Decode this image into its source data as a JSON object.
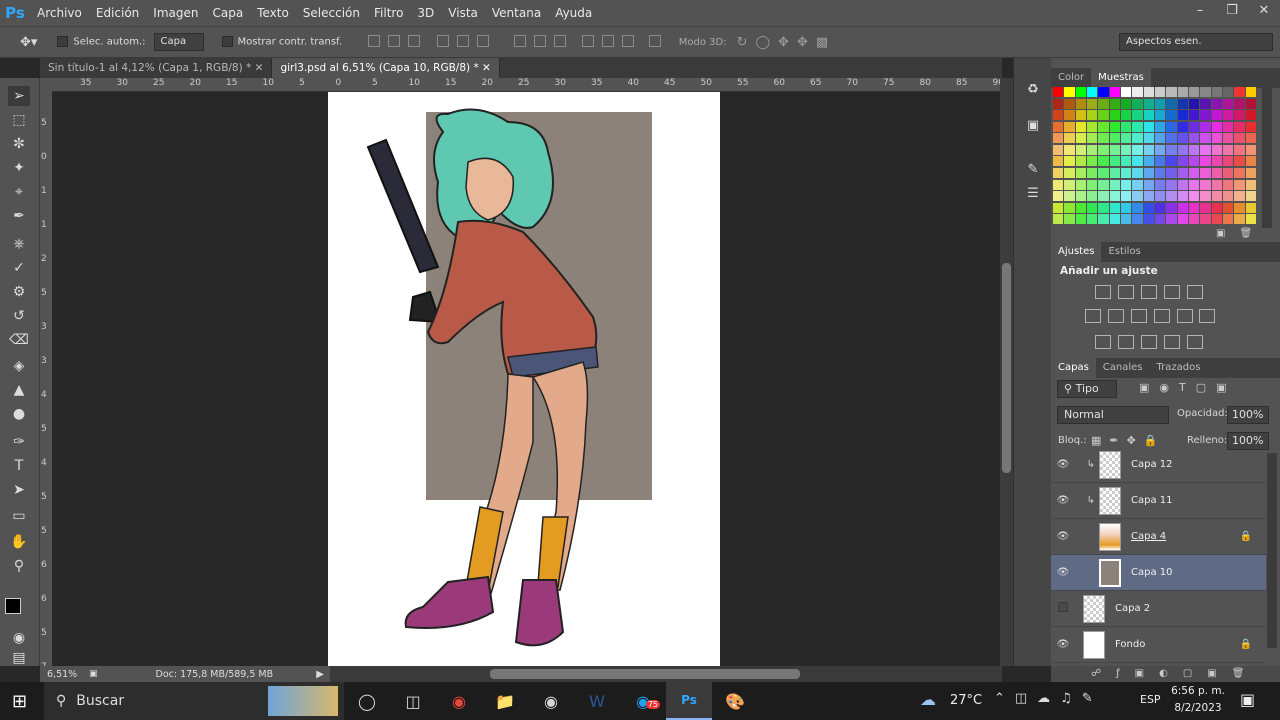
{
  "menu": {
    "items": [
      "Archivo",
      "Edición",
      "Imagen",
      "Capa",
      "Texto",
      "Selección",
      "Filtro",
      "3D",
      "Vista",
      "Ventana",
      "Ayuda"
    ]
  },
  "options": {
    "auto_select": "Selec. autom.:",
    "layer_select": "Capa",
    "show_transform": "Mostrar contr. transf.",
    "mode3d": "Modo 3D:",
    "workspace": "Aspectos esen."
  },
  "tabs": [
    {
      "label": "Sin título-1 al 4,12% (Capa 1, RGB/8) *"
    },
    {
      "label": "girl3.psd al 6,51% (Capa 10, RGB/8) *"
    }
  ],
  "ruler": {
    "top": [
      "35",
      "30",
      "25",
      "20",
      "15",
      "10",
      "5",
      "0",
      "5",
      "10",
      "15",
      "20",
      "25",
      "30",
      "35",
      "40",
      "45",
      "50",
      "55",
      "60",
      "65",
      "70",
      "75",
      "80",
      "85",
      "90"
    ],
    "left": [
      "5",
      "0",
      "1",
      "1",
      "2",
      "5",
      "3",
      "3",
      "4",
      "5",
      "4",
      "5",
      "5",
      "6",
      "6",
      "5",
      "7"
    ]
  },
  "status": {
    "zoom": "6,51%",
    "doc": "Doc: 175,8 MB/589,5 MB"
  },
  "panels": {
    "color_tabs": [
      "Color",
      "Muestras"
    ],
    "adjust_tabs": [
      "Ajustes",
      "Estilos"
    ],
    "adjust_title": "Añadir un ajuste",
    "layer_tabs": [
      "Capas",
      "Canales",
      "Trazados"
    ],
    "filter": "Tipo",
    "blend": "Normal",
    "opacity_label": "Opacidad:",
    "opacity": "100%",
    "lock_label": "Bloq.:",
    "fill_label": "Relleno:",
    "fill": "100%"
  },
  "layers": [
    {
      "name": "Capa 12",
      "visible": true
    },
    {
      "name": "Capa 11",
      "visible": true
    },
    {
      "name": "Capa 4",
      "visible": true
    },
    {
      "name": "Capa 10",
      "visible": true
    },
    {
      "name": "Capa 2",
      "visible": false
    },
    {
      "name": "Fondo",
      "visible": true
    }
  ],
  "taskbar": {
    "search": "Buscar",
    "temp": "27°C",
    "lang": "ESP",
    "time": "6:56 p. m.",
    "date": "8/2/2023",
    "badge": "75",
    "notif": "4"
  }
}
